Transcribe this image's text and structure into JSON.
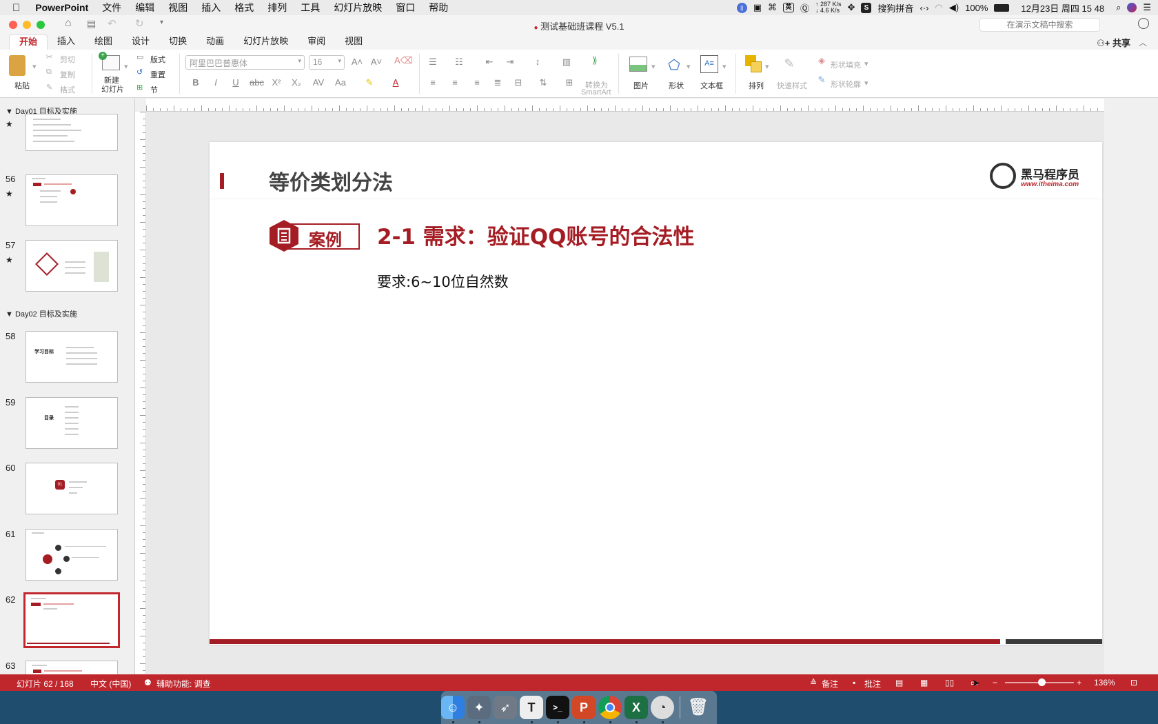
{
  "menubar": {
    "app_name": "PowerPoint",
    "items": [
      "文件",
      "编辑",
      "视图",
      "插入",
      "格式",
      "排列",
      "工具",
      "幻灯片放映",
      "窗口",
      "帮助"
    ],
    "net_up": "↑ 287 K/s",
    "net_down": "↓ 4.6 K/s",
    "ime": "搜狗拼音",
    "ime_mode": "英",
    "battery": "100%",
    "clock": "12月23日 周四 15 48"
  },
  "window": {
    "doc_title": "测试基础班课程 V5.1",
    "search_placeholder": "在演示文稿中搜索"
  },
  "tabs": {
    "items": [
      "开始",
      "插入",
      "绘图",
      "设计",
      "切换",
      "动画",
      "幻灯片放映",
      "审阅",
      "视图"
    ],
    "active": "开始",
    "share": "共享"
  },
  "ribbon": {
    "paste": "粘贴",
    "cut": "剪切",
    "copy": "复制",
    "format": "格式",
    "new_slide": "新建",
    "new_slide2": "幻灯片",
    "layout": "版式",
    "reset": "重置",
    "section": "节",
    "font_name": "阿里巴巴普惠体",
    "font_size": "16",
    "convert": "转换为",
    "smartart": "SmartArt",
    "picture": "图片",
    "shape": "形状",
    "textbox": "文本框",
    "arrange": "排列",
    "quick_styles": "快速样式",
    "shape_fill": "形状填充",
    "shape_outline": "形状轮廓"
  },
  "sidebar": {
    "sections": [
      "Day01 目标及实施",
      "Day02 目标及实施"
    ],
    "slides": [
      {
        "num": "",
        "star": "★"
      },
      {
        "num": "56",
        "star": "★"
      },
      {
        "num": "57",
        "star": "★"
      },
      {
        "num": "58",
        "star": ""
      },
      {
        "num": "59",
        "star": ""
      },
      {
        "num": "60",
        "star": ""
      },
      {
        "num": "61",
        "star": ""
      },
      {
        "num": "62",
        "star": ""
      },
      {
        "num": "63",
        "star": ""
      }
    ],
    "thumb_texts": {
      "s58": "学习目标",
      "s59": "目录",
      "s60": "01"
    }
  },
  "slide": {
    "title": "等价类划分法",
    "logo_name": "黑马程序员",
    "logo_url": "www.itheima.com",
    "badge": "案例",
    "case_title": "2-1 需求：验证QQ账号的合法性",
    "requirement": "要求:6~10位自然数",
    "accent": "#a51d24"
  },
  "statusbar": {
    "slide_pos": "幻灯片 62 / 168",
    "language": "中文 (中国)",
    "accessibility": "辅助功能: 调查",
    "notes": "备注",
    "comments": "批注",
    "zoom": "136%"
  }
}
